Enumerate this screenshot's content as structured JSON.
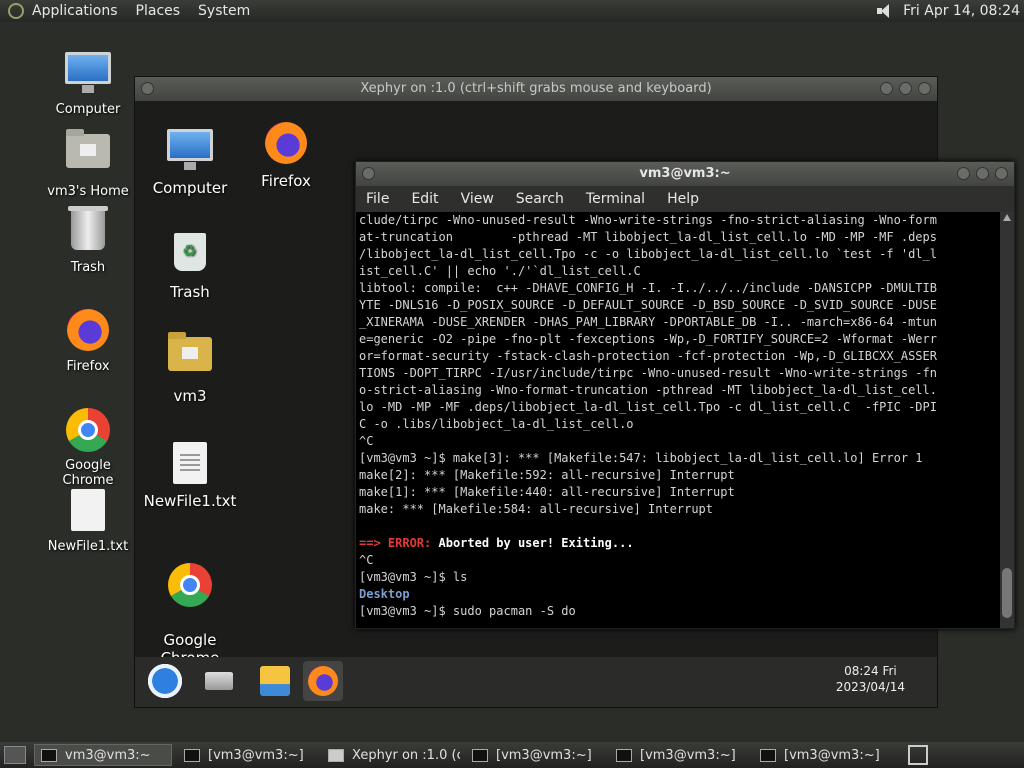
{
  "top_panel": {
    "menus": [
      "Applications",
      "Places",
      "System"
    ],
    "clock": "Fri Apr 14, 08:24"
  },
  "desktop_icons": [
    "Computer",
    "vm3's Home",
    "Trash",
    "Firefox",
    "Google Chrome",
    "NewFile1.txt"
  ],
  "xephyr": {
    "title": "Xephyr on :1.0 (ctrl+shift grabs mouse and keyboard)",
    "icons": [
      "Computer",
      "Firefox",
      "Trash",
      "vm3",
      "NewFile1.txt",
      "Google\nChrome"
    ],
    "dock_clock_time": "08:24 Fri",
    "dock_clock_date": "2023/04/14"
  },
  "terminal": {
    "title": "vm3@vm3:~",
    "menu": [
      "File",
      "Edit",
      "View",
      "Search",
      "Terminal",
      "Help"
    ],
    "lines": [
      "clude/tirpc -Wno-unused-result -Wno-write-strings -fno-strict-aliasing -Wno-form",
      "at-truncation        -pthread -MT libobject_la-dl_list_cell.lo -MD -MP -MF .deps",
      "/libobject_la-dl_list_cell.Tpo -c -o libobject_la-dl_list_cell.lo `test -f 'dl_l",
      "ist_cell.C' || echo './'`dl_list_cell.C",
      "libtool: compile:  c++ -DHAVE_CONFIG_H -I. -I../../../include -DANSICPP -DMULTIB",
      "YTE -DNLS16 -D_POSIX_SOURCE -D_DEFAULT_SOURCE -D_BSD_SOURCE -D_SVID_SOURCE -DUSE",
      "_XINERAMA -DUSE_XRENDER -DHAS_PAM_LIBRARY -DPORTABLE_DB -I.. -march=x86-64 -mtun",
      "e=generic -O2 -pipe -fno-plt -fexceptions -Wp,-D_FORTIFY_SOURCE=2 -Wformat -Werr",
      "or=format-security -fstack-clash-protection -fcf-protection -Wp,-D_GLIBCXX_ASSER",
      "TIONS -DOPT_TIRPC -I/usr/include/tirpc -Wno-unused-result -Wno-write-strings -fn",
      "o-strict-aliasing -Wno-format-truncation -pthread -MT libobject_la-dl_list_cell.",
      "lo -MD -MP -MF .deps/libobject_la-dl_list_cell.Tpo -c dl_list_cell.C  -fPIC -DPI",
      "C -o .libs/libobject_la-dl_list_cell.o",
      "^C",
      "[vm3@vm3 ~]$ make[3]: *** [Makefile:547: libobject_la-dl_list_cell.lo] Error 1",
      "make[2]: *** [Makefile:592: all-recursive] Interrupt",
      "make[1]: *** [Makefile:440: all-recursive] Interrupt",
      "make: *** [Makefile:584: all-recursive] Interrupt",
      ""
    ],
    "err_arrow": "==> ",
    "err_label": "ERROR:",
    "err_msg": " Aborted by user! Exiting...",
    "after": [
      "^C",
      "[vm3@vm3 ~]$ ls"
    ],
    "ls_output": "Desktop",
    "prompt_cmd": "[vm3@vm3 ~]$ sudo pacman -S do"
  },
  "taskbar": {
    "tasks": [
      "vm3@vm3:~",
      "[vm3@vm3:~]",
      "Xephyr on :1.0 (ct...",
      "[vm3@vm3:~]",
      "[vm3@vm3:~]",
      "[vm3@vm3:~]"
    ]
  }
}
